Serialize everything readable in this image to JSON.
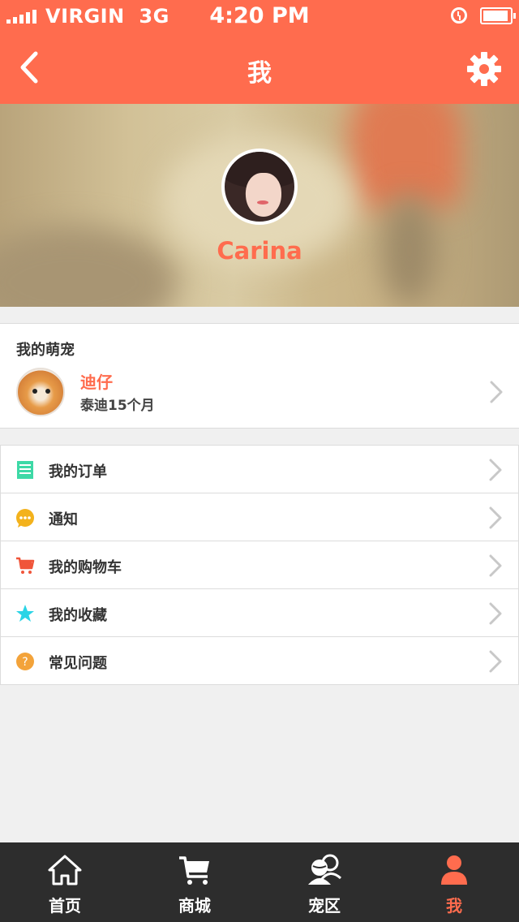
{
  "status_bar": {
    "carrier": "VIRGIN",
    "network": "3G",
    "time": "4:20 PM"
  },
  "nav": {
    "title": "我"
  },
  "profile": {
    "username": "Carina"
  },
  "pet_section": {
    "heading": "我的萌宠",
    "pet_name": "迪仔",
    "pet_desc": "泰迪15个月"
  },
  "menu": {
    "items": [
      {
        "label": "我的订单",
        "icon": "order-list-icon"
      },
      {
        "label": "通知",
        "icon": "notification-bubble-icon"
      },
      {
        "label": "我的购物车",
        "icon": "shopping-cart-icon"
      },
      {
        "label": "我的收藏",
        "icon": "star-icon"
      },
      {
        "label": "常见问题",
        "icon": "question-icon"
      }
    ]
  },
  "tabbar": {
    "tabs": [
      {
        "label": "首页",
        "icon": "home-icon"
      },
      {
        "label": "商城",
        "icon": "cart-icon"
      },
      {
        "label": "宠区",
        "icon": "community-icon"
      },
      {
        "label": "我",
        "icon": "person-icon"
      }
    ],
    "active_index": 3
  },
  "colors": {
    "accent": "#ff6c4e",
    "tabbar_bg": "#2d2d2d",
    "page_bg": "#f0f0f0"
  }
}
